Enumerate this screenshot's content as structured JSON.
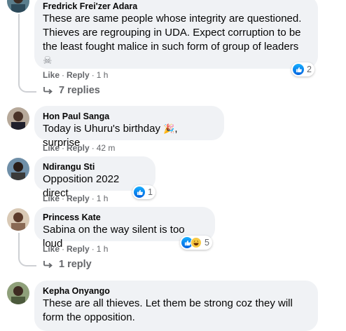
{
  "comments": [
    {
      "author": "Fredrick Frei'zer Adara",
      "text": "These are same people whose integrity are questioned. Thieves are regrouping in UDA. Expect corruption to be the least fought malice in such form of group of leaders",
      "emoji": "☠",
      "like": "Like",
      "reply": "Reply",
      "time": "1 h",
      "reaction_count": "2",
      "replies_label": "7 replies"
    },
    {
      "author": "Hon Paul Sanga",
      "text_before": "Today is Uhuru's birthday ",
      "emoji": "🎉",
      "text_after": ", surprise",
      "like": "Like",
      "reply": "Reply",
      "time": "42 m"
    },
    {
      "author": "Ndirangu Sti",
      "text": "Opposition 2022 direct",
      "like": "Like",
      "reply": "Reply",
      "time": "1 h",
      "reaction_count": "1"
    },
    {
      "author": "Princess Kate",
      "text": "Sabina on the way silent is too loud",
      "like": "Like",
      "reply": "Reply",
      "time": "1 h",
      "reaction_count": "5",
      "replies_label": "1 reply"
    },
    {
      "author": "Kepha Onyango",
      "text": "These are all thieves. Let them be strong coz they will form the opposition."
    }
  ],
  "colors": {
    "bubble": "#f0f2f5",
    "meta": "#65676b",
    "like_blue": "#1877f2",
    "thread": "#ced0d4"
  },
  "icons": [
    "like-icon",
    "haha-icon",
    "reply-arrow-icon",
    "skull-crossbones-icon",
    "party-popper-icon"
  ]
}
